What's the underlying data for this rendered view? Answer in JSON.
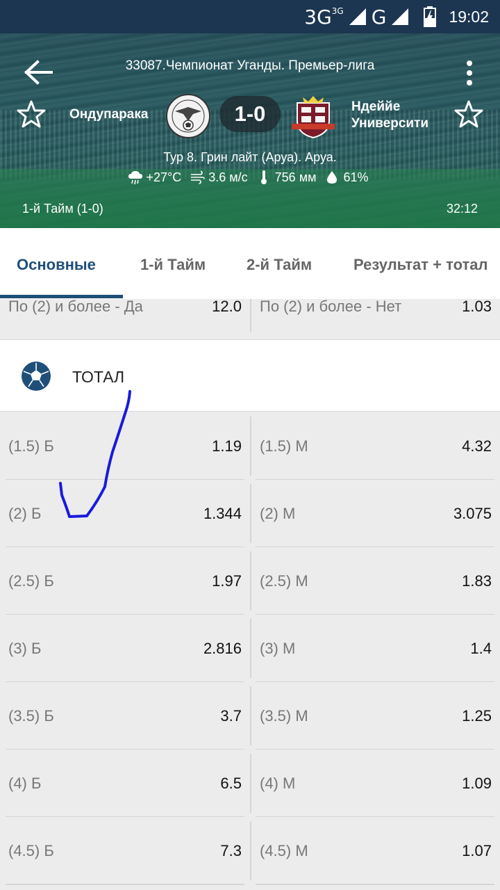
{
  "status_bar": {
    "network_1": "3G",
    "network_1_sup": "3G",
    "network_2": "G",
    "time": "19:02"
  },
  "header": {
    "league": "33087.Чемпионат Уганды. Премьер-лига",
    "team1": "Ондупарака",
    "team2_line1": "Ндеййе",
    "team2_line2": "Университи",
    "score": "1-0",
    "venue": "Тур 8. Грин лайт (Аруа). Аруа.",
    "weather": {
      "temperature": "+27°C",
      "wind": "3.6 м/с",
      "pressure": "756 мм",
      "humidity": "61%"
    },
    "period": "1-й  Тайм (1-0)",
    "match_time": "32:12"
  },
  "tabs": [
    {
      "label": "Основные",
      "active": true
    },
    {
      "label": "1-й  Тайм"
    },
    {
      "label": "2-й  Тайм"
    },
    {
      "label": "Результат + тотал"
    }
  ],
  "partial_row": {
    "left_name": "По (2) и более - Да",
    "left_odd": "12.0",
    "right_name": "По (2) и более - Нет",
    "right_odd": "1.03"
  },
  "section": {
    "title": "ТОТАЛ",
    "icon": "soccer-ball-icon"
  },
  "totals": [
    {
      "left_name": "(1.5) Б",
      "left_odd": "1.19",
      "right_name": "(1.5) М",
      "right_odd": "4.32"
    },
    {
      "left_name": "(2) Б",
      "left_odd": "1.344",
      "right_name": "(2) М",
      "right_odd": "3.075"
    },
    {
      "left_name": "(2.5) Б",
      "left_odd": "1.97",
      "right_name": "(2.5) М",
      "right_odd": "1.83"
    },
    {
      "left_name": "(3) Б",
      "left_odd": "2.816",
      "right_name": "(3) М",
      "right_odd": "1.4"
    },
    {
      "left_name": "(3.5) Б",
      "left_odd": "3.7",
      "right_name": "(3.5) М",
      "right_odd": "1.25"
    },
    {
      "left_name": "(4) Б",
      "left_odd": "6.5",
      "right_name": "(4) М",
      "right_odd": "1.09"
    },
    {
      "left_name": "(4.5) Б",
      "left_odd": "7.3",
      "right_name": "(4.5) М",
      "right_odd": "1.07"
    }
  ],
  "colors": {
    "status_bar": "#1c3550",
    "accent": "#1f4f79",
    "scribble": "#1a1adc"
  }
}
